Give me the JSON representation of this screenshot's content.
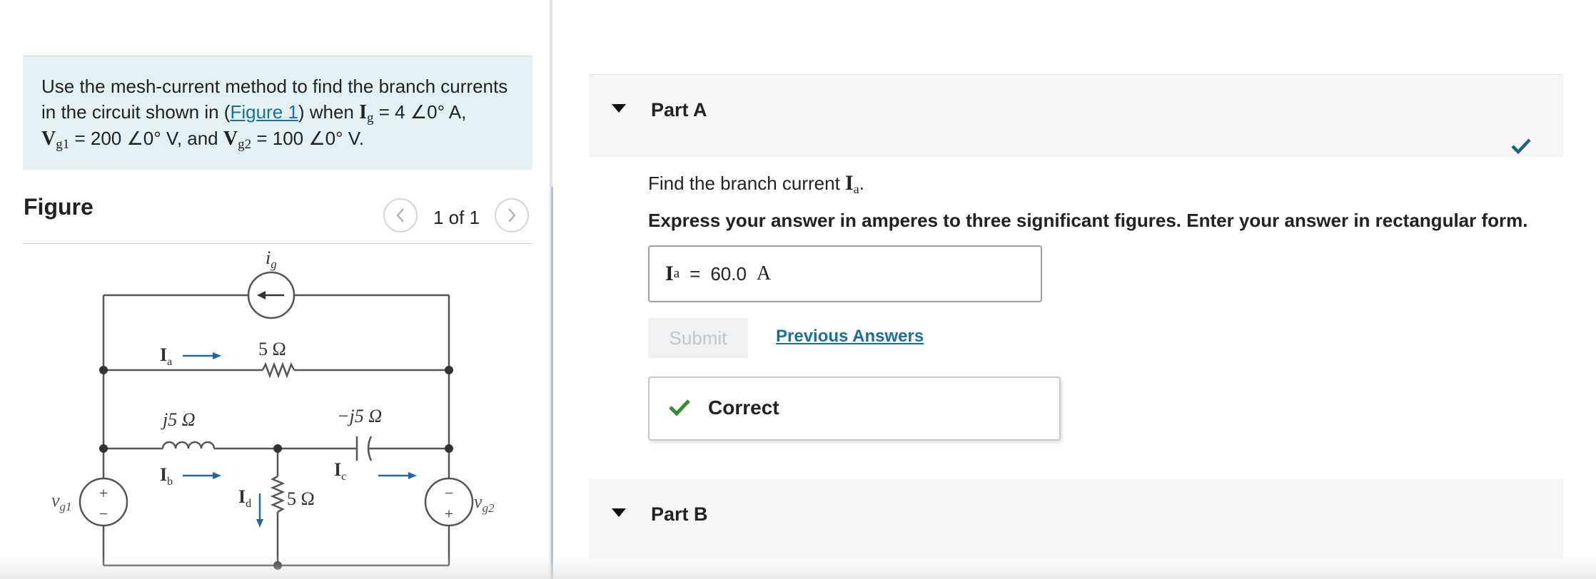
{
  "problem": {
    "text_part1": "Use the mesh-current method to find the branch currents in the circuit shown in (",
    "figure_link": "Figure 1",
    "text_part2": ") when ",
    "ig_symbol": "I",
    "ig_sub": "g",
    "ig_value": " = 4 ∠0° A,",
    "vg1_symbol": "V",
    "vg1_sub": "g1",
    "vg1_value": " = 200 ∠0° V, and ",
    "vg2_symbol": "V",
    "vg2_sub": "g2",
    "vg2_value": " = 100 ∠0° V."
  },
  "figure": {
    "title": "Figure",
    "page_count": "1 of 1"
  },
  "circuit": {
    "ig_label": "i",
    "ig_sub": "g",
    "r_top": "5 Ω",
    "l_label": "j5 Ω",
    "c_label": "−j5 Ω",
    "r_mid": "5 Ω",
    "ia_label": "I",
    "ia_sub": "a",
    "ib_label": "I",
    "ib_sub": "b",
    "ic_label": "I",
    "ic_sub": "c",
    "id_label": "I",
    "id_sub": "d",
    "vg1_label": "v",
    "vg1_sub": "g1",
    "vg2_label": "v",
    "vg2_sub": "g2",
    "plus": "+",
    "minus": "−"
  },
  "part_a": {
    "title": "Part A",
    "question_prefix": "Find the branch current ",
    "question_symbol": "I",
    "question_sub": "a",
    "question_suffix": ".",
    "instruction": "Express your answer in amperes to three significant figures. Enter your answer in rectangular form.",
    "answer_symbol": "I",
    "answer_sub": "a",
    "answer_eq": "=",
    "answer_value": "60.0",
    "answer_unit": "A",
    "submit_label": "Submit",
    "previous_answers_label": "Previous Answers",
    "feedback_label": "Correct"
  },
  "part_b": {
    "title": "Part B"
  },
  "colors": {
    "link": "#1a6fa0",
    "problem_bg": "#e3f1f5",
    "correct_green": "#3a8a3a",
    "check_blue": "#1f5f82",
    "circuit_arrow": "#2367a0"
  }
}
